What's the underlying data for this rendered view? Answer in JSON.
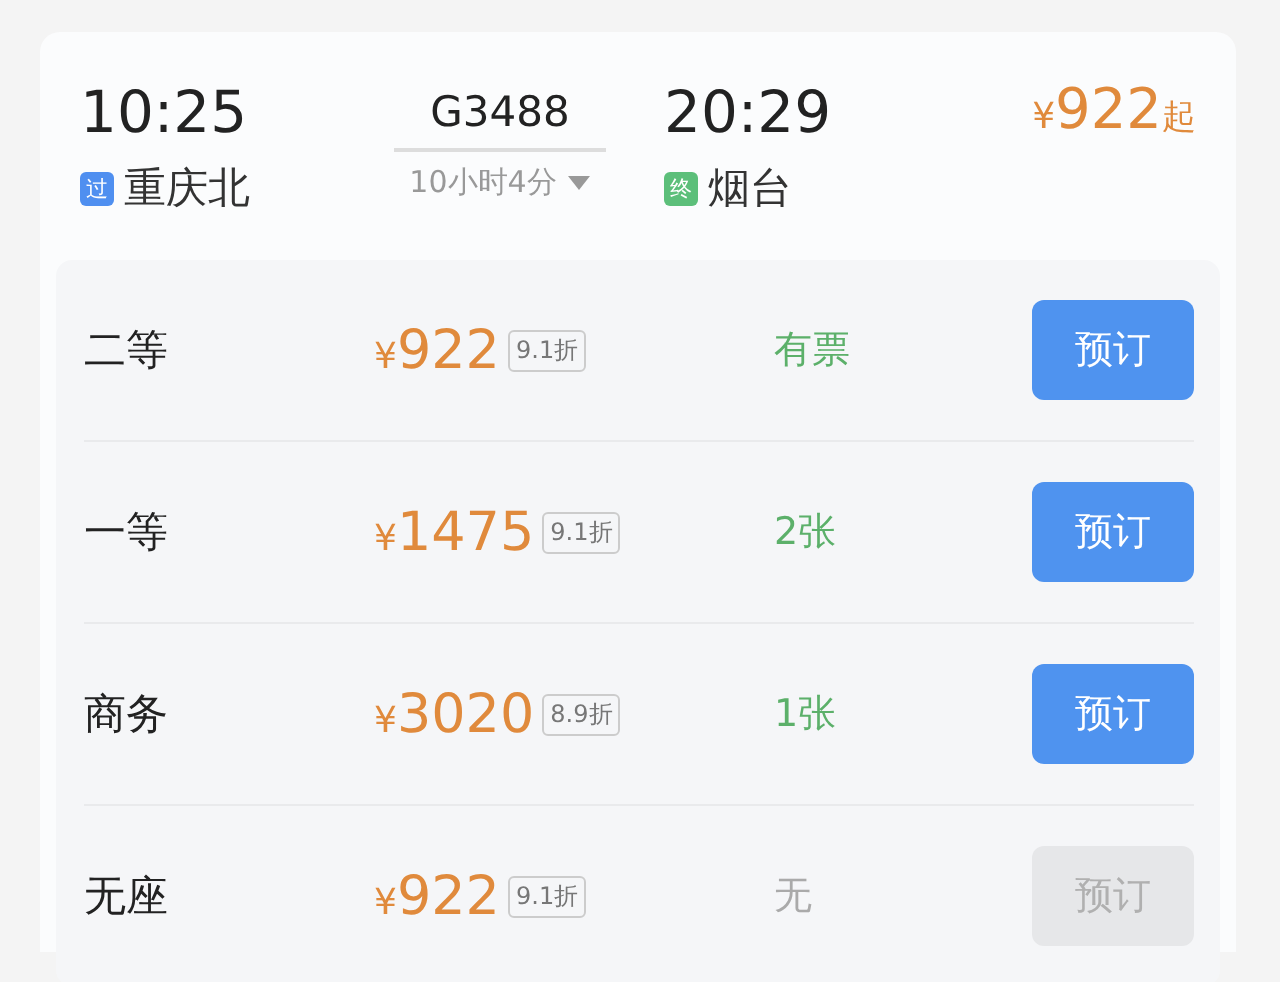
{
  "train": {
    "depart_time": "10:25",
    "depart_tag": "过",
    "depart_station": "重庆北",
    "number": "G3488",
    "duration": "10小时4分",
    "arrive_time": "20:29",
    "arrive_tag": "终",
    "arrive_station": "烟台",
    "currency": "¥",
    "min_price": "922",
    "price_suffix": "起"
  },
  "seats": [
    {
      "name": "二等",
      "currency": "¥",
      "price": "922",
      "discount": "9.1折",
      "availability": "有票",
      "available": true,
      "button": "预订",
      "disabled": false
    },
    {
      "name": "一等",
      "currency": "¥",
      "price": "1475",
      "discount": "9.1折",
      "availability": "2张",
      "available": true,
      "button": "预订",
      "disabled": false
    },
    {
      "name": "商务",
      "currency": "¥",
      "price": "3020",
      "discount": "8.9折",
      "availability": "1张",
      "available": true,
      "button": "预订",
      "disabled": false
    },
    {
      "name": "无座",
      "currency": "¥",
      "price": "922",
      "discount": "9.1折",
      "availability": "无",
      "available": false,
      "button": "预订",
      "disabled": true
    }
  ]
}
